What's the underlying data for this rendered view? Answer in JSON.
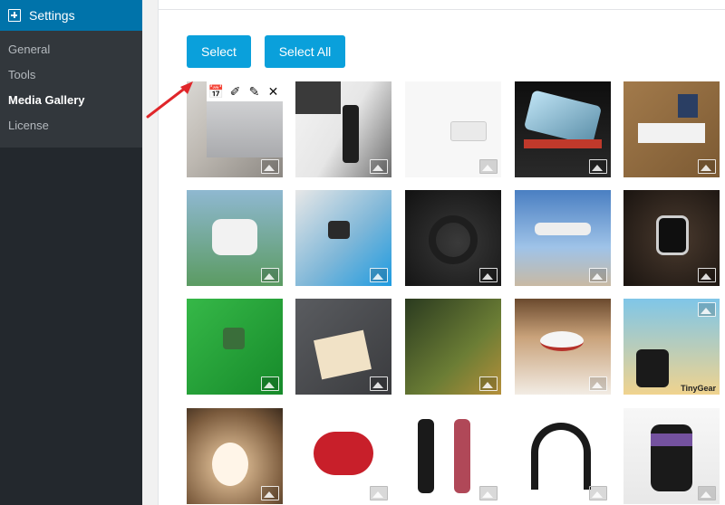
{
  "sidebar": {
    "title": "Settings",
    "items": [
      {
        "label": "General"
      },
      {
        "label": "Tools"
      },
      {
        "label": "Media Gallery"
      },
      {
        "label": "License"
      }
    ]
  },
  "toolbar": {
    "select_label": "Select",
    "select_all_label": "Select All"
  },
  "gallery": {
    "watermark_text": "TinyGear",
    "hover_tools": [
      "calendar-icon",
      "dropper-icon",
      "pencil-icon",
      "close-icon"
    ]
  },
  "colors": {
    "sidebar_bg": "#23282d",
    "sidebar_head": "#0073aa",
    "button": "#0aa0db",
    "arrow": "#e0262a"
  }
}
